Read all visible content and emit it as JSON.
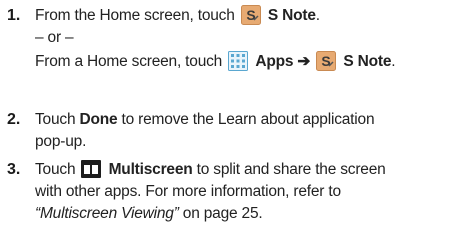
{
  "steps": [
    {
      "number": "1.",
      "lines": {
        "l1_pre": "From the Home screen, touch",
        "l1_bold": "S Note",
        "l1_post": ".",
        "l2": "– or –",
        "l3_pre": "From a Home screen, touch",
        "l3_bold1": "Apps",
        "l3_arrow": "➔",
        "l3_bold2": "S Note",
        "l3_post": "."
      },
      "icons": [
        "s-note-icon",
        "apps-grid-icon",
        "s-note-icon"
      ]
    },
    {
      "number": "2.",
      "lines": {
        "l1_pre": "Touch",
        "l1_bold": "Done",
        "l1_post": "to remove the Learn about application",
        "l2": "pop-up."
      }
    },
    {
      "number": "3.",
      "lines": {
        "l1_pre": "Touch",
        "l1_bold": "Multiscreen",
        "l1_post": "to split and share the screen",
        "l2": "with other apps. For more information, refer to",
        "l3_italic": "“Multiscreen Viewing”",
        "l3_post": "on page 25."
      },
      "icons": [
        "multiscreen-icon"
      ]
    }
  ],
  "colors": {
    "text": "#222222",
    "s_note_bg": "#e7aa72",
    "apps_grid": "#5aa7d0",
    "multiscreen_bg": "#1d1d1d"
  }
}
